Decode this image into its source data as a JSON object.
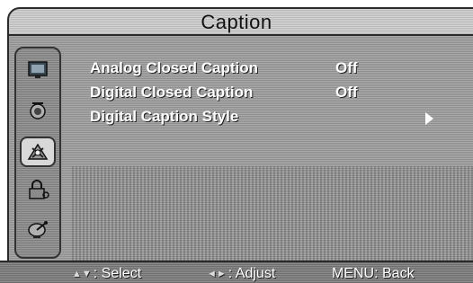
{
  "header": {
    "title": "Caption"
  },
  "sidebar": {
    "items": [
      {
        "icon": "picture-icon"
      },
      {
        "icon": "sound-icon"
      },
      {
        "icon": "setup-icon",
        "selected": true
      },
      {
        "icon": "lock-icon"
      },
      {
        "icon": "channel-icon"
      }
    ]
  },
  "menu": {
    "items": [
      {
        "label": "Analog Closed Caption",
        "value": "Off"
      },
      {
        "label": "Digital Closed Caption",
        "value": "Off"
      },
      {
        "label": "Digital Caption Style",
        "value": ""
      }
    ]
  },
  "footer": {
    "select_icons": "▲▼",
    "select_label": ": Select",
    "adjust_icons": "◄►",
    "adjust_label": ": Adjust",
    "back_label": "MENU: Back"
  }
}
